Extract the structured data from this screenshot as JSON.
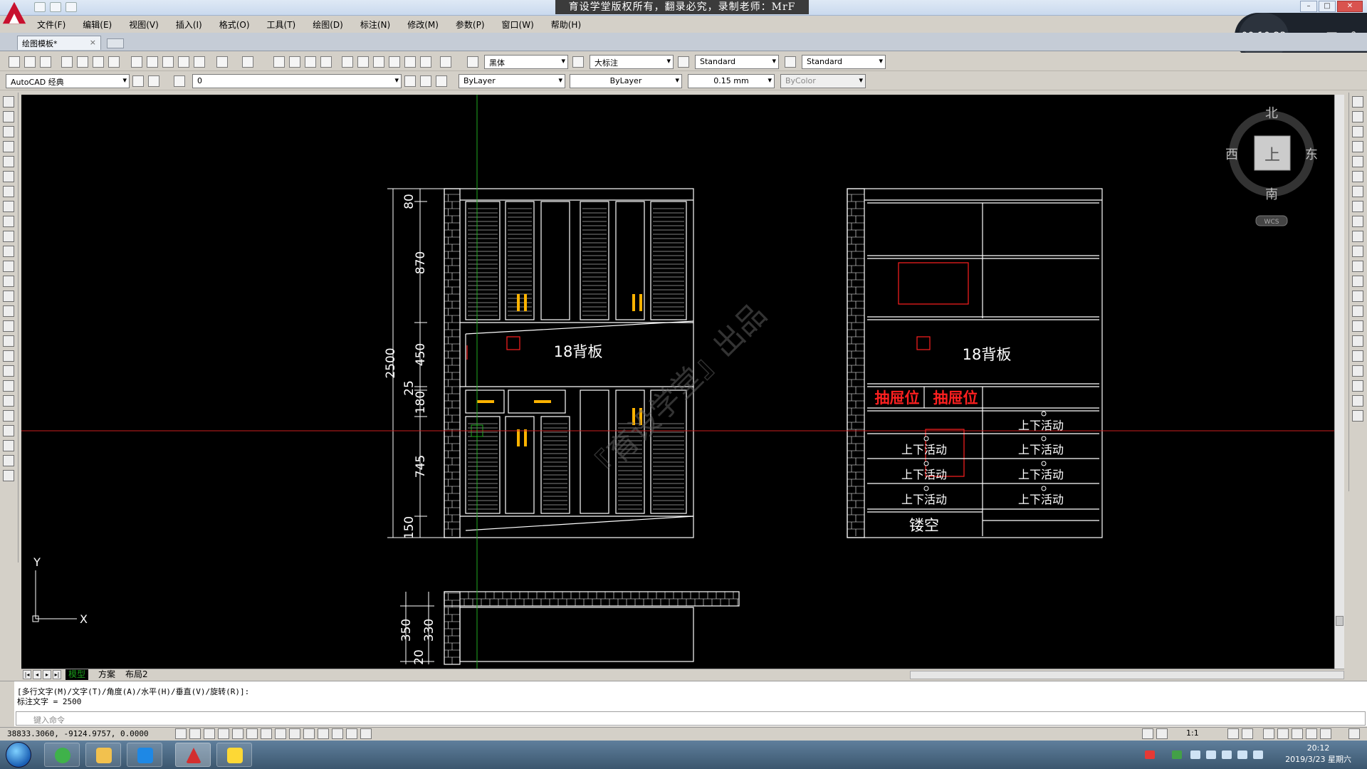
{
  "title_banner": "育设学堂版权所有，翻录必究，录制老师：MrF",
  "recorder": {
    "time": "00:10:23",
    "pause": "⏸",
    "stop": "■",
    "pen": "✎"
  },
  "window_controls": {
    "minimize": "–",
    "maximize": "□",
    "close": "✕"
  },
  "menus": [
    "文件(F)",
    "编辑(E)",
    "视图(V)",
    "插入(I)",
    "格式(O)",
    "工具(T)",
    "绘图(D)",
    "标注(N)",
    "修改(M)",
    "参数(P)",
    "窗口(W)",
    "帮助(H)"
  ],
  "doc_tab": {
    "label": "绘图模板*",
    "close": "×"
  },
  "toolbar1": {
    "text_style_font": "黑体",
    "dim_style": "大标注",
    "table_style": "Standard",
    "multileader_style": "Standard"
  },
  "toolbar2": {
    "workspace": "AutoCAD 经典",
    "layer": "0",
    "color": "ByLayer",
    "linetype": "ByLayer",
    "lineweight": "0.15 mm",
    "plotstyle": "ByColor"
  },
  "viewcube": {
    "north": "北",
    "south": "南",
    "east": "东",
    "west": "西",
    "face": "上",
    "wcs": "WCS"
  },
  "ucs": {
    "x": "X",
    "y": "Y"
  },
  "drawing": {
    "dims_left": [
      "80",
      "870",
      "450",
      "25",
      "180",
      "745",
      "150"
    ],
    "dim_total": "2500",
    "dims_bottom": [
      "350",
      "330",
      "20"
    ],
    "backboard_label": "18背板",
    "drawer_label": "抽屉位",
    "adjustable_label": "上下活动",
    "hollow_label": "镂空",
    "diagonal_watermark": "『育设学堂』出品",
    "colors": {
      "lines": "#ffffff",
      "red": "#ff2020",
      "green": "#22aa22",
      "crosshair_red": "#cc2020",
      "gold": "#ffb300"
    }
  },
  "layout_tabs": [
    "模型",
    "方案",
    "布局2"
  ],
  "command": {
    "line1": "[多行文字(M)/文字(T)/角度(A)/水平(H)/垂直(V)/旋转(R)]:",
    "line2": "标注文字 = 2500",
    "placeholder": "键入命令"
  },
  "status": {
    "coords": "38833.3060, -9124.9757, 0.0000",
    "anno_scale": "1:1"
  },
  "clock": {
    "time": "20:12",
    "date": "2019/3/23 星期六"
  }
}
